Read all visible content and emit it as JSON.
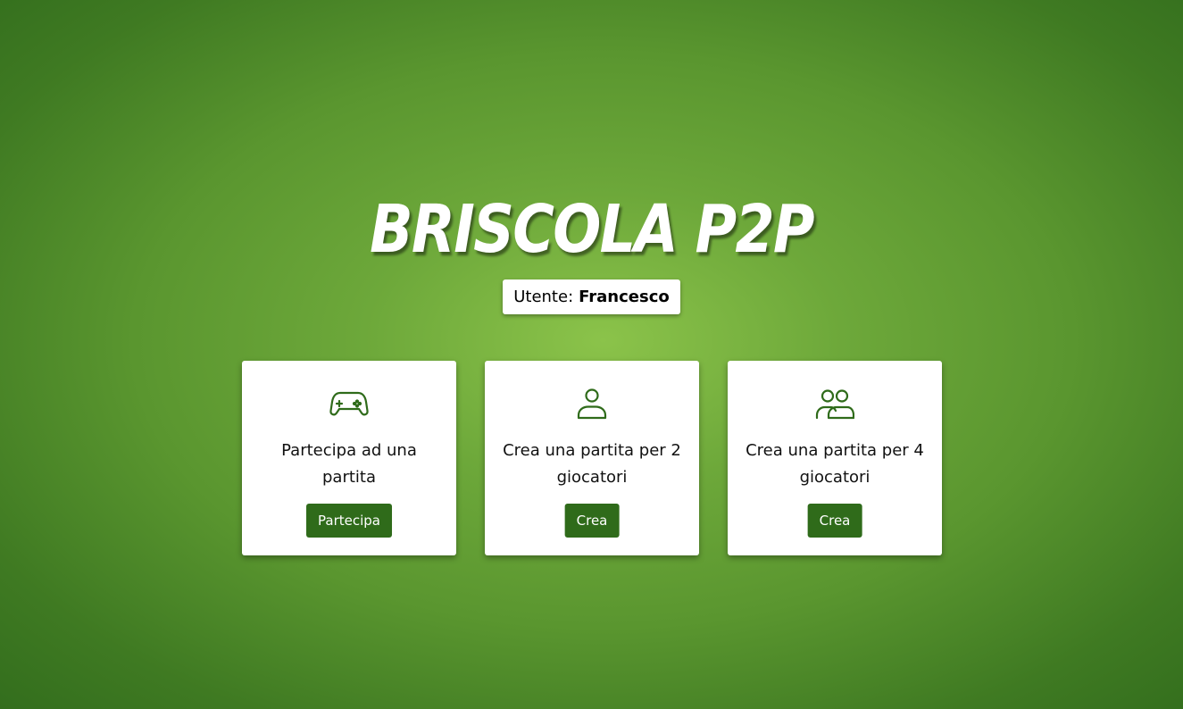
{
  "app": {
    "title": "BRISCOLA P2P"
  },
  "user": {
    "label": "Utente:",
    "name": "Francesco"
  },
  "cards": [
    {
      "icon": "gamepad-icon",
      "text": "Partecipa ad una partita",
      "button_label": "Partecipa"
    },
    {
      "icon": "user-icon",
      "text": "Crea una partita per 2 giocatori",
      "button_label": "Crea"
    },
    {
      "icon": "users-icon",
      "text": "Crea una partita per 4 giocatori",
      "button_label": "Crea"
    }
  ],
  "colors": {
    "accent": "#2f6b1a",
    "background_center": "#8bc34a",
    "background_edge": "#336e1d",
    "card": "#ffffff"
  }
}
